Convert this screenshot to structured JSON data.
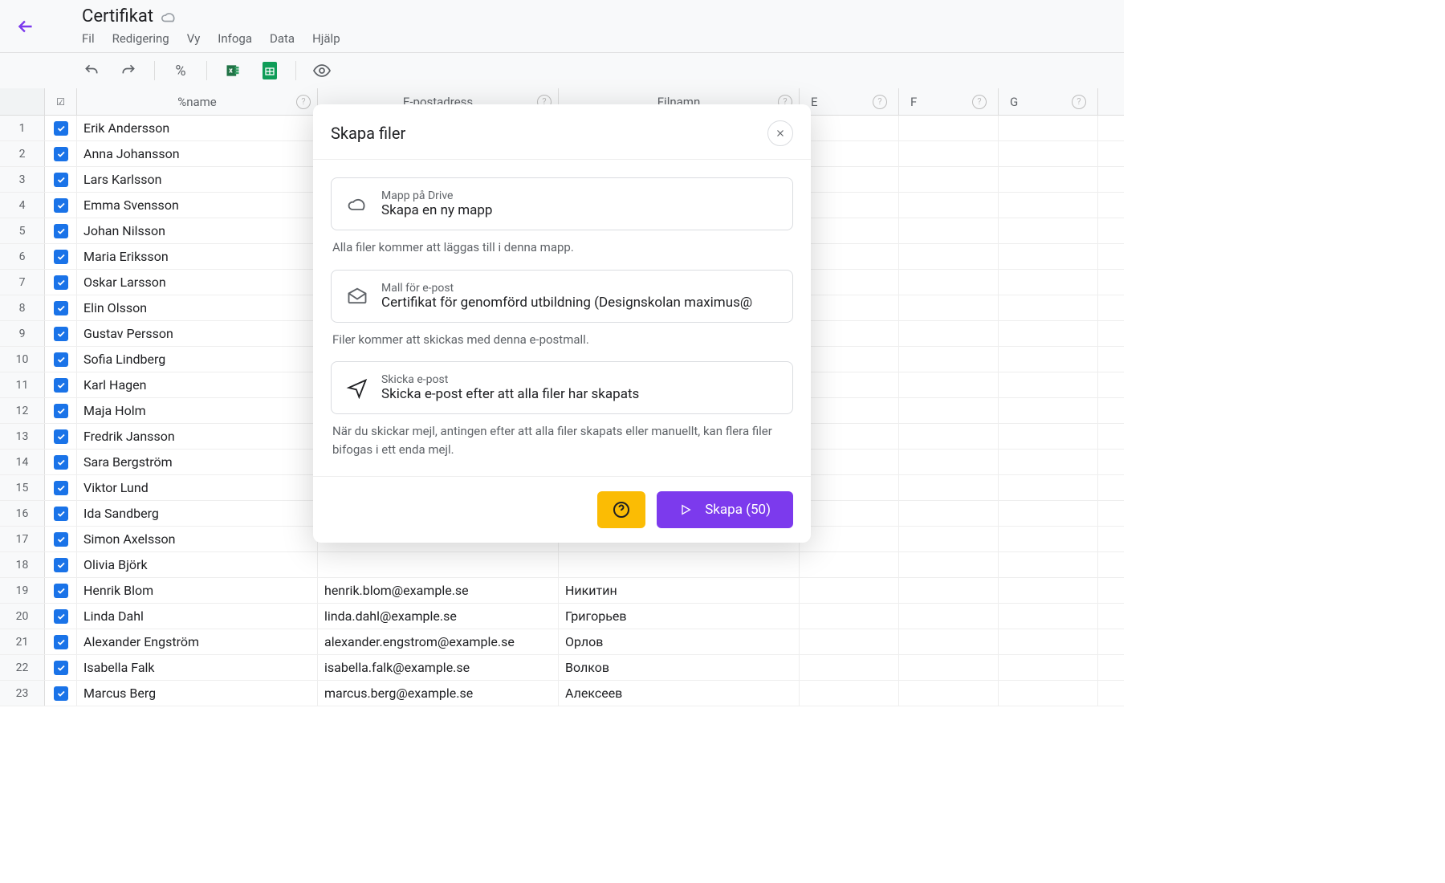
{
  "document": {
    "title": "Certifikat"
  },
  "menu": [
    "Fil",
    "Redigering",
    "Vy",
    "Infoga",
    "Data",
    "Hjälp"
  ],
  "columns": {
    "check_header": "☑",
    "name": "%name",
    "email": "E-postadress",
    "file": "Filnamn",
    "letters": [
      "E",
      "F",
      "G"
    ]
  },
  "rows": [
    {
      "n": "1",
      "name": "Erik Andersson",
      "email": "",
      "file": ""
    },
    {
      "n": "2",
      "name": "Anna Johansson",
      "email": "",
      "file": ""
    },
    {
      "n": "3",
      "name": "Lars Karlsson",
      "email": "",
      "file": ""
    },
    {
      "n": "4",
      "name": "Emma Svensson",
      "email": "",
      "file": ""
    },
    {
      "n": "5",
      "name": "Johan Nilsson",
      "email": "",
      "file": ""
    },
    {
      "n": "6",
      "name": "Maria Eriksson",
      "email": "",
      "file": ""
    },
    {
      "n": "7",
      "name": "Oskar Larsson",
      "email": "",
      "file": ""
    },
    {
      "n": "8",
      "name": "Elin Olsson",
      "email": "",
      "file": ""
    },
    {
      "n": "9",
      "name": "Gustav Persson",
      "email": "",
      "file": ""
    },
    {
      "n": "10",
      "name": "Sofia Lindberg",
      "email": "",
      "file": ""
    },
    {
      "n": "11",
      "name": "Karl Hagen",
      "email": "",
      "file": ""
    },
    {
      "n": "12",
      "name": "Maja Holm",
      "email": "",
      "file": ""
    },
    {
      "n": "13",
      "name": "Fredrik Jansson",
      "email": "",
      "file": ""
    },
    {
      "n": "14",
      "name": "Sara Bergström",
      "email": "",
      "file": ""
    },
    {
      "n": "15",
      "name": "Viktor Lund",
      "email": "",
      "file": ""
    },
    {
      "n": "16",
      "name": "Ida Sandberg",
      "email": "",
      "file": ""
    },
    {
      "n": "17",
      "name": "Simon Axelsson",
      "email": "",
      "file": ""
    },
    {
      "n": "18",
      "name": "Olivia Björk",
      "email": "",
      "file": ""
    },
    {
      "n": "19",
      "name": "Henrik Blom",
      "email": "henrik.blom@example.se",
      "file": "Никитин"
    },
    {
      "n": "20",
      "name": "Linda Dahl",
      "email": "linda.dahl@example.se",
      "file": "Григорьев"
    },
    {
      "n": "21",
      "name": "Alexander Engström",
      "email": "alexander.engstrom@example.se",
      "file": "Орлов"
    },
    {
      "n": "22",
      "name": "Isabella Falk",
      "email": "isabella.falk@example.se",
      "file": "Волков"
    },
    {
      "n": "23",
      "name": "Marcus Berg",
      "email": "marcus.berg@example.se",
      "file": "Алексеев"
    }
  ],
  "modal": {
    "title": "Skapa filer",
    "folder": {
      "label": "Mapp på Drive",
      "value": "Skapa en ny mapp",
      "desc": "Alla filer kommer att läggas till i denna mapp."
    },
    "template": {
      "label": "Mall för e-post",
      "value": "Certifikat för genomförd utbildning (Designskolan maximus@",
      "desc": "Filer kommer att skickas med denna e-postmall."
    },
    "send": {
      "label": "Skicka e-post",
      "value": "Skicka e-post efter att alla filer har skapats",
      "desc": "När du skickar mejl, antingen efter att alla filer skapats eller manuellt, kan flera filer bifogas i ett enda mejl."
    },
    "primary": "Skapa (50)"
  }
}
